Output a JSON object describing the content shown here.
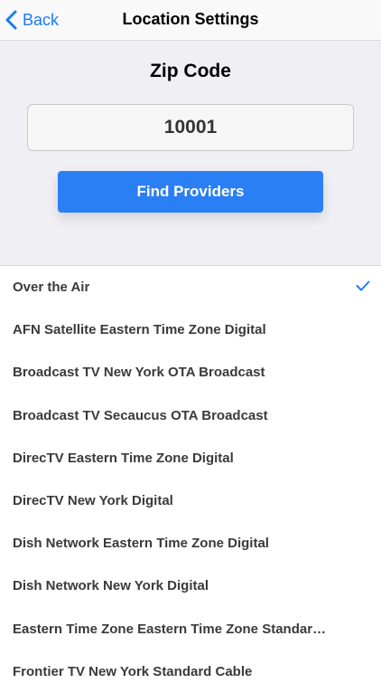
{
  "nav": {
    "back_label": "Back",
    "title": "Location Settings"
  },
  "zip": {
    "label": "Zip Code",
    "value": "10001",
    "button_label": "Find Providers"
  },
  "providers": [
    {
      "label": "Over the Air",
      "selected": true
    },
    {
      "label": "AFN Satellite Eastern Time Zone Digital",
      "selected": false
    },
    {
      "label": "Broadcast TV New York OTA Broadcast",
      "selected": false
    },
    {
      "label": "Broadcast TV Secaucus OTA Broadcast",
      "selected": false
    },
    {
      "label": "DirecTV Eastern Time Zone Digital",
      "selected": false
    },
    {
      "label": "DirecTV New York Digital",
      "selected": false
    },
    {
      "label": "Dish Network Eastern Time Zone Digital",
      "selected": false
    },
    {
      "label": "Dish Network New York Digital",
      "selected": false
    },
    {
      "label": "Eastern Time Zone Eastern Time Zone Standar…",
      "selected": false
    },
    {
      "label": "Frontier TV New York Standard Cable",
      "selected": false
    }
  ],
  "icons": {
    "back": "chevron-left-icon",
    "selected": "checkmark-icon"
  },
  "colors": {
    "accent": "#1a7cf5",
    "button": "#2b7ff5",
    "section_bg": "#efeff4"
  }
}
